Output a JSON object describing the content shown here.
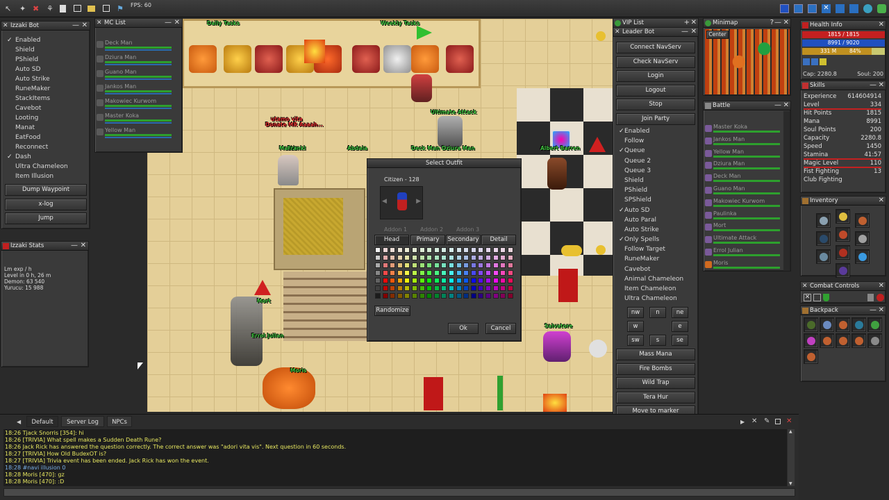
{
  "toolbar": {
    "fps": "FPS: 60"
  },
  "bot_panel": {
    "title": "Izzaki Bot",
    "options": [
      {
        "label": "Enabled",
        "checked": true
      },
      {
        "label": "Shield",
        "checked": false
      },
      {
        "label": "PShield",
        "checked": false
      },
      {
        "label": "Auto SD",
        "checked": false
      },
      {
        "label": "Auto Strike",
        "checked": false
      },
      {
        "label": "RuneMaker",
        "checked": false
      },
      {
        "label": "StackItems",
        "checked": false
      },
      {
        "label": "Cavebot",
        "checked": false
      },
      {
        "label": "Looting",
        "checked": false
      },
      {
        "label": "Manat",
        "checked": false
      },
      {
        "label": "EatFood",
        "checked": false
      },
      {
        "label": "Reconnect",
        "checked": false
      },
      {
        "label": "Dash",
        "checked": true
      },
      {
        "label": "Ultra Chameleon",
        "checked": false
      },
      {
        "label": "Item Illusion",
        "checked": false
      }
    ],
    "buttons": [
      "Dump Waypoint",
      "x-log",
      "Jump"
    ]
  },
  "stats_panel": {
    "title": "Izzaki Stats",
    "lines": [
      "Lm exp / h",
      "Level in 0 h, 26 m",
      "Demon: 63 540",
      "Yurucu: 15 988"
    ]
  },
  "mc_list": {
    "title": "MC List",
    "names": [
      "Deck Man",
      "Dziura Man",
      "Guano Man",
      "Jankos Man",
      "Makowiec Kurwom",
      "Master Koka",
      "Yellow Man"
    ]
  },
  "game": {
    "labels": [
      {
        "t": "Daily Tasks"
      },
      {
        "t": "Weekly Tasks"
      },
      {
        "t": "Ultimate Attack"
      },
      {
        "t": "utamo vita"
      },
      {
        "t": "Donate MR Aaaah..."
      },
      {
        "t": "Mastir"
      },
      {
        "t": "Abdala"
      },
      {
        "t": "Deck Man"
      },
      {
        "t": "Dziura Man"
      },
      {
        "t": "Albert Barren"
      },
      {
        "t": "Mort"
      },
      {
        "t": "Errol Julian"
      },
      {
        "t": "Salvatore"
      },
      {
        "t": "Moris"
      },
      {
        "t": "Frankl"
      }
    ]
  },
  "dialog": {
    "title": "Select Outfit",
    "outfit_name": "Citizen - 128",
    "addons": [
      "Addon 1",
      "Addon 2",
      "Addon 3"
    ],
    "tabs": [
      "Head",
      "Primary",
      "Secondary",
      "Detail"
    ],
    "randomize": "Randomize",
    "ok": "Ok",
    "cancel": "Cancel"
  },
  "vip": {
    "title": "VIP List"
  },
  "leader_bot": {
    "title": "Leader Bot",
    "buttons_top": [
      "Connect NavServ",
      "Check NavServ",
      "Login",
      "Logout",
      "Stop",
      "Join Party"
    ],
    "options": [
      {
        "label": "Enabled",
        "checked": true
      },
      {
        "label": "Follow",
        "checked": false
      },
      {
        "label": "Queue",
        "checked": true
      },
      {
        "label": "Queue 2",
        "checked": false
      },
      {
        "label": "Queue 3",
        "checked": false
      },
      {
        "label": "Shield",
        "checked": false
      },
      {
        "label": "PShield",
        "checked": false
      },
      {
        "label": "SPShield",
        "checked": false
      },
      {
        "label": "Auto SD",
        "checked": true
      },
      {
        "label": "Auto Paral",
        "checked": false
      },
      {
        "label": "Auto Strike",
        "checked": false
      },
      {
        "label": "Only Spells",
        "checked": true
      },
      {
        "label": "Follow Target",
        "checked": false
      },
      {
        "label": "RuneMaker",
        "checked": false
      },
      {
        "label": "Cavebot",
        "checked": false
      },
      {
        "label": "Animal Chameleon",
        "checked": false
      },
      {
        "label": "Item Chameleon",
        "checked": false
      },
      {
        "label": "Ultra Chameleon",
        "checked": false
      }
    ],
    "dirs": [
      "nw",
      "n",
      "ne",
      "w",
      "e",
      "sw",
      "s",
      "se"
    ],
    "buttons_bottom": [
      "Mass Mana",
      "Fire Bombs",
      "Wild Trap",
      "Tera Hur",
      "Move to marker"
    ]
  },
  "minimap": {
    "title": "Minimap",
    "center": "Center"
  },
  "battle": {
    "title": "Battle",
    "names": [
      "Master Koka",
      "Jankos Man",
      "Yellow Man",
      "Dziura Man",
      "Deck Man",
      "Guano Man",
      "Makowiec Kurwom",
      "Paulinka",
      "Mort",
      "Ultimate Attack",
      "Errol Julian",
      "Moris"
    ]
  },
  "health": {
    "title": "Health Info",
    "hp": "1815 / 1815",
    "mp": "8991 / 9020",
    "cap_left": "331 M",
    "cap_right": "84%",
    "cap": "Cap: 2280.8",
    "soul": "Soul: 200"
  },
  "skills": {
    "title": "Skills",
    "rows": [
      {
        "k": "Experience",
        "v": "614604914"
      },
      {
        "k": "Level",
        "v": "334"
      },
      {
        "k": "Hit Points",
        "v": "1815"
      },
      {
        "k": "Mana",
        "v": "8991"
      },
      {
        "k": "Soul Points",
        "v": "200"
      },
      {
        "k": "Capacity",
        "v": "2280.8"
      },
      {
        "k": "Speed",
        "v": "1450"
      },
      {
        "k": "Stamina",
        "v": "41:57"
      },
      {
        "k": "Magic Level",
        "v": "110"
      },
      {
        "k": "Fist Fighting",
        "v": "13"
      },
      {
        "k": "Club Fighting",
        "v": ""
      }
    ]
  },
  "inventory": {
    "title": "Inventory"
  },
  "combat": {
    "title": "Combat Controls"
  },
  "backpack": {
    "title": "Backpack"
  },
  "chat": {
    "tabs": [
      "Default",
      "Server Log",
      "NPCs"
    ],
    "lines": [
      {
        "t": "18:26 Tjack Snorris [354]: hi",
        "c": "#e8e860"
      },
      {
        "t": "18:26 [TRIVIA] What spell makes a Sudden Death Rune?",
        "c": "#e8e860"
      },
      {
        "t": "18:26 Jack Rick has answered the question correctly. The correct answer was \"adori vita vis\". Next question in 60 seconds.",
        "c": "#e8e860"
      },
      {
        "t": "18:27 [TRIVIA] How Old BudexOT is?",
        "c": "#e8e860"
      },
      {
        "t": "18:27 [TRIVIA] Trivia event has been ended. Jack Rick has won the event.",
        "c": "#e8e860"
      },
      {
        "t": "18:28 #navi illusion 0",
        "c": "#7ab0e8"
      },
      {
        "t": "18:28 Moris [470]: gz",
        "c": "#e8e860"
      },
      {
        "t": "18:28 Moris [470]: :D",
        "c": "#e8e860"
      }
    ]
  },
  "colors": {
    "panel": "#3a3a3a",
    "hp": "#c42020",
    "mp": "#2050c0",
    "accent": "#e8e860"
  }
}
